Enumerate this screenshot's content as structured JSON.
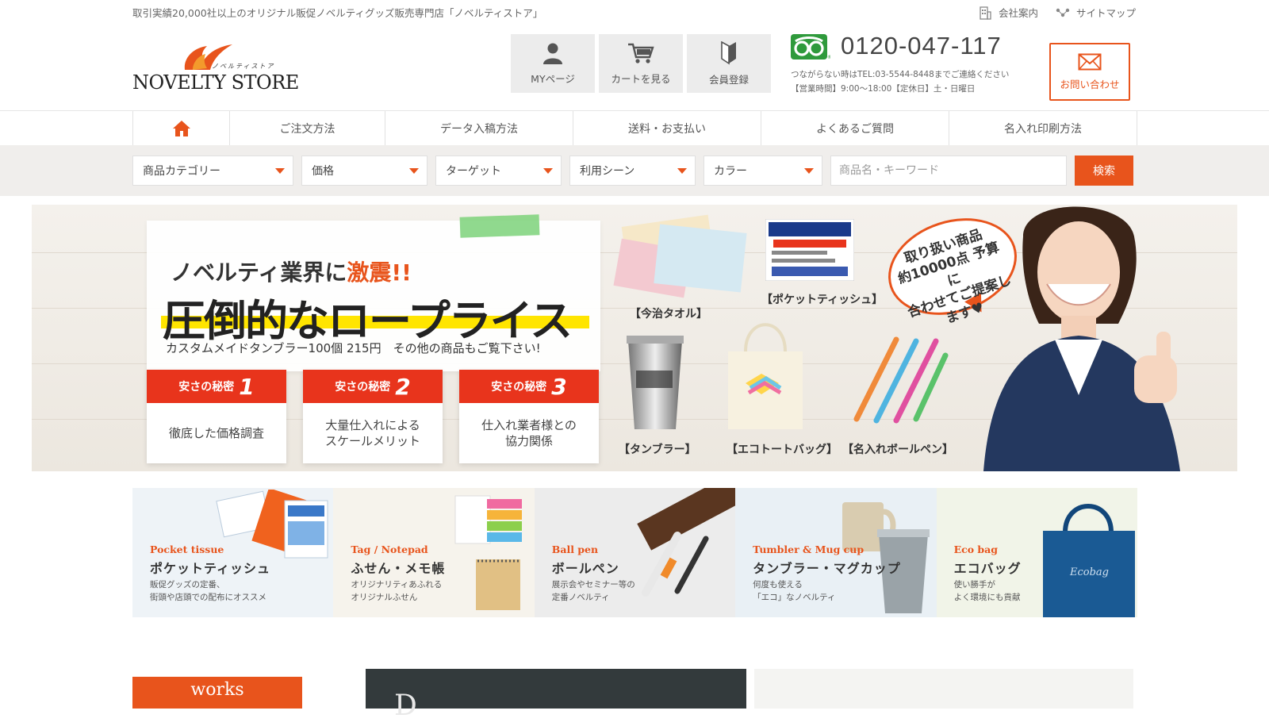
{
  "header": {
    "tagline": "取引実績20,000社以上のオリジナル販促ノベルティグッズ販売専門店「ノベルティストア」",
    "top_links": [
      {
        "label": "会社案内",
        "icon": "building-icon"
      },
      {
        "label": "サイトマップ",
        "icon": "sitemap-icon"
      }
    ],
    "logo": {
      "text": "NOVELTY STORE",
      "kana": "ノベルティストア"
    },
    "buttons": {
      "mypage": "MYページ",
      "cart": "カートを見る",
      "register": "会員登録"
    },
    "phone": "0120-047-117",
    "phone_sub1": "つながらない時はTEL:03-5544-8448までご連絡ください",
    "phone_sub2": "【営業時間】9:00～18:00【定休日】土・日曜日",
    "contact": "お問い合わせ"
  },
  "nav": [
    {
      "label": "",
      "icon": "home-icon"
    },
    {
      "label": "ご注文方法"
    },
    {
      "label": "データ入稿方法"
    },
    {
      "label": "送料・お支払い"
    },
    {
      "label": "よくあるご質問"
    },
    {
      "label": "名入れ印刷方法"
    }
  ],
  "search": {
    "selects": [
      "商品カテゴリー",
      "価格",
      "ターゲット",
      "利用シーン",
      "カラー"
    ],
    "placeholder": "商品名・キーワード",
    "button": "検索"
  },
  "hero": {
    "headline_pre": "ノベルティ業界に",
    "headline_em": "激震!!",
    "main": "圧倒的なロープライス",
    "sub": "カスタムメイドタンブラー100個 215円　その他の商品もご覧下さい!",
    "secrets": [
      {
        "title": "安さの秘密",
        "num": "1",
        "body": "徹底した価格調査"
      },
      {
        "title": "安さの秘密",
        "num": "2",
        "body": "大量仕入れによる\nスケールメリット"
      },
      {
        "title": "安さの秘密",
        "num": "3",
        "body": "仕入れ業者様との\n協力関係"
      }
    ],
    "products": [
      "【今治タオル】",
      "【ポケットティッシュ】",
      "【タンブラー】",
      "【エコトートバッグ】",
      "【名入れボールペン】"
    ],
    "bubble": "取り扱い商品\n約10000点 予算に\n合わせてご提案します♥"
  },
  "categories": [
    {
      "en": "Pocket tissue",
      "jp": "ポケットティッシュ",
      "desc": "販促グッズの定番、\n街頭や店頭での配布にオススメ",
      "bg": "#eef3f7"
    },
    {
      "en": "Tag / Notepad",
      "jp": "ふせん・メモ帳",
      "desc": "オリジナリティあふれる\nオリジナルふせん",
      "bg": "#f6f3ec"
    },
    {
      "en": "Ball pen",
      "jp": "ボールペン",
      "desc": "展示会やセミナー等の\n定番ノベルティ",
      "bg": "#ececec"
    },
    {
      "en": "Tumbler & Mug cup",
      "jp": "タンブラー・マグカップ",
      "desc": "何度も使える\n「エコ」なノベルティ",
      "bg": "#e9f0f5"
    },
    {
      "en": "Eco bag",
      "jp": "エコバッグ",
      "desc": "使い勝手が\nよく環境にも貢献",
      "bg": "#f1f4e8"
    }
  ],
  "bottom": {
    "works": "works",
    "dark_text": "D"
  },
  "colors": {
    "accent": "#e8541c",
    "freedial": "#2f9a3c",
    "highlight": "#ffe500"
  }
}
